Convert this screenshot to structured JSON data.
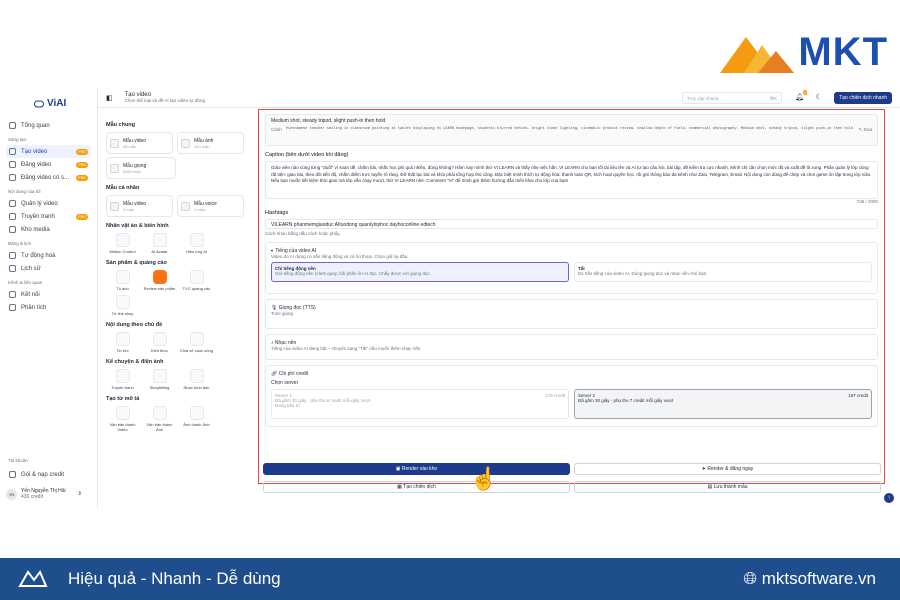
{
  "brand": {
    "name": "MKT"
  },
  "app": {
    "logo": "ViAI"
  },
  "sidebar": {
    "items": [
      {
        "label": "Tổng quan",
        "section": ""
      },
      {
        "label": "Tạo video",
        "section": "Sáng tạo",
        "pro": "PRO",
        "active": true
      },
      {
        "label": "Đăng video",
        "pro": "PRO"
      },
      {
        "label": "Đăng video có s...",
        "pro": "PRO"
      },
      {
        "label": "Quản lý video",
        "section": "Nội dung của tôi"
      },
      {
        "label": "Truyền tranh",
        "pro": "PRO"
      },
      {
        "label": "Kho media"
      },
      {
        "label": "Tự động hoá",
        "section": "Đăng & lịch"
      },
      {
        "label": "Lịch sử"
      },
      {
        "label": "Kết nối",
        "section": "Kênh & liên quan"
      },
      {
        "label": "Phân tích"
      }
    ],
    "account_section": "Tài khoản",
    "plan": "Gói & nạp credit",
    "user_name": "Yến Nguyễn Thị Hải",
    "user_credit": "436 credit",
    "user_initials": "YN"
  },
  "topbar": {
    "title": "Tạo video",
    "subtitle": "Chọn thể loại và đề AI tạo video tự động",
    "search": "Truy cập nhanh...",
    "search_kbd": "⌘K",
    "notif": "2",
    "cta": "Tạo chiến dịch nhanh"
  },
  "templates": {
    "g1": "Mẫu chung",
    "cards1": [
      {
        "t": "Mẫu video",
        "s": "68 mẫu"
      },
      {
        "t": "Mẫu ảnh",
        "s": "104 mẫu"
      }
    ],
    "card1b": {
      "t": "Mẫu giọng",
      "s": "6320 mẫu"
    },
    "g2": "Mẫu cá nhân",
    "cards2": [
      {
        "t": "Mẫu video",
        "s": "3 mẫu"
      },
      {
        "t": "Mẫu voice",
        "s": "1 mẫu"
      }
    ],
    "g3": "Nhân vật ảo & biến hình",
    "tools3": [
      "Motion Control",
      "AI Avatar",
      "Hiệu ứng AI"
    ],
    "g4": "Sản phẩm & quảng cáo",
    "tools4": [
      "Tù ảnh",
      "Review sản phẩm",
      "TVC quảng cáo",
      "Từ link shop"
    ],
    "g5": "Nội dung theo chủ đề",
    "tools5": [
      "Tin tức",
      "Kiến thức",
      "Chia sẻ cuộc sống"
    ],
    "g6": "Kể chuyện & điện ảnh",
    "tools6": [
      "Truyện tranh",
      "Storytelling",
      "Nhạc hình ảnh"
    ],
    "g7": "Tạo từ mô tả",
    "tools7": [
      "Văn bản thành Video",
      "Văn bản thành Ảnh",
      "Ảnh thành Ảnh"
    ]
  },
  "main": {
    "shot_text": "Medium shot, steady tripod, slight push-in then hold",
    "prompt_label": "Cảnh",
    "prompt_text": "Vietnamese teacher smiling in classroom pointing at tablet displaying Vi LEARN homepage, students blurred behind, bright clean lighting, cinematic product review, shallow depth of field, commercial photography. Medium shot, steady tripod, slight push-in then hold",
    "edit": "Sửa",
    "caption_label": "Caption (bên dưới video khi đăng)",
    "caption_text": "Giáo viên nào cũng từng \"đuối\" vì soạn đề, chấm bài, nhắc học phí quá nhiều, đúng không? Hãm nay mình thử VI LEARN và thấy nhẹ việc hẳn. VI LEARN cho bạn tối tài liệu lên và AI tự tạo câu hỏi, bài tập, đề kiểm tra cực nhanh. Mình chỉ cần chọn mức độ và xuất đề là xong. Phần quản lý lớp cũng rất tiện: giao bài, theo dõi tiến độ, chấm điểm trực tuyến rõ ràng. Đỡ thất lạc bài và khỏi phải tổng hợp thủ công. Đặc biệt mình thích tự động hóa: thanh toán QR, kích hoạt quyền học, rồi gửi thông báo đa kênh như Zalo, Telegram, Email. Nội dung còn dùng để chép và chơi game ôn tập trong lớp nữa. Nếu bạn muốn tiết kiệm thời gian mà lớp vẫn chạy mượt, thử VI LEARN nhé. Comment \"Vi\" để mình gửi thêm hướng dẫn triển khai cho lớp của bạn!",
    "caption_count": "736 / 2000",
    "hashtags_label": "Hashtags",
    "hashtags": "VILEARN phanmemgiaoduc AItuodong quanlylophoc dayhoconline edtech",
    "hashtags_hint": "Cách nhau bằng dấu cách hoặc phẩy.",
    "audio_title": "Tiếng của video AI",
    "audio_desc": "Video do AI dựng có sẵn tiếng động và cả lời thoại. Chọn giữ lại đầu.",
    "audio_opt1": "Chỉ tiếng động nền",
    "audio_opt1_desc": "Giữ tiếng động nền (cảnh quay, bối phần lời AI đọc. Chấy được với giọng đọc.",
    "audio_opt2": "Tắt",
    "audio_opt2_desc": "Bỏ hẳn tiếng của video AI. Dùng giọng đọc và nhạc nền chủ bạn.",
    "voice_title": "Giọng đọc (TTS)",
    "voice_desc": "Tone giọng",
    "music_title": "Nhạc nền",
    "music_desc": "Tiếng của video AI đang bật – chuyển sang \"Tắt\" nếu muốn thêm nhạc nền.",
    "credit_title": "Chi phí credit",
    "server_label": "Chọn server",
    "server1": "Server 1",
    "server1_credit": "178 credit",
    "server1_desc": "Đã gồm 30 giây · phụ thu 6 credit mỗi giây vượt",
    "server1_note": "Đang bảo trì",
    "server2": "Server 2",
    "server2_credit": "187 credit",
    "server2_desc": "Đã gồm 30 giây · phụ thu 7 credit mỗi giây vượt"
  },
  "actions": {
    "render": "Render vào kho",
    "render_post": "Render & đăng ngay",
    "campaign": "Tạo chiến dịch",
    "save": "Lưu thành mẫu"
  },
  "footer": {
    "tagline": "Hiệu quả - Nhanh - Dễ dùng",
    "site": "mktsoftware.vn"
  }
}
